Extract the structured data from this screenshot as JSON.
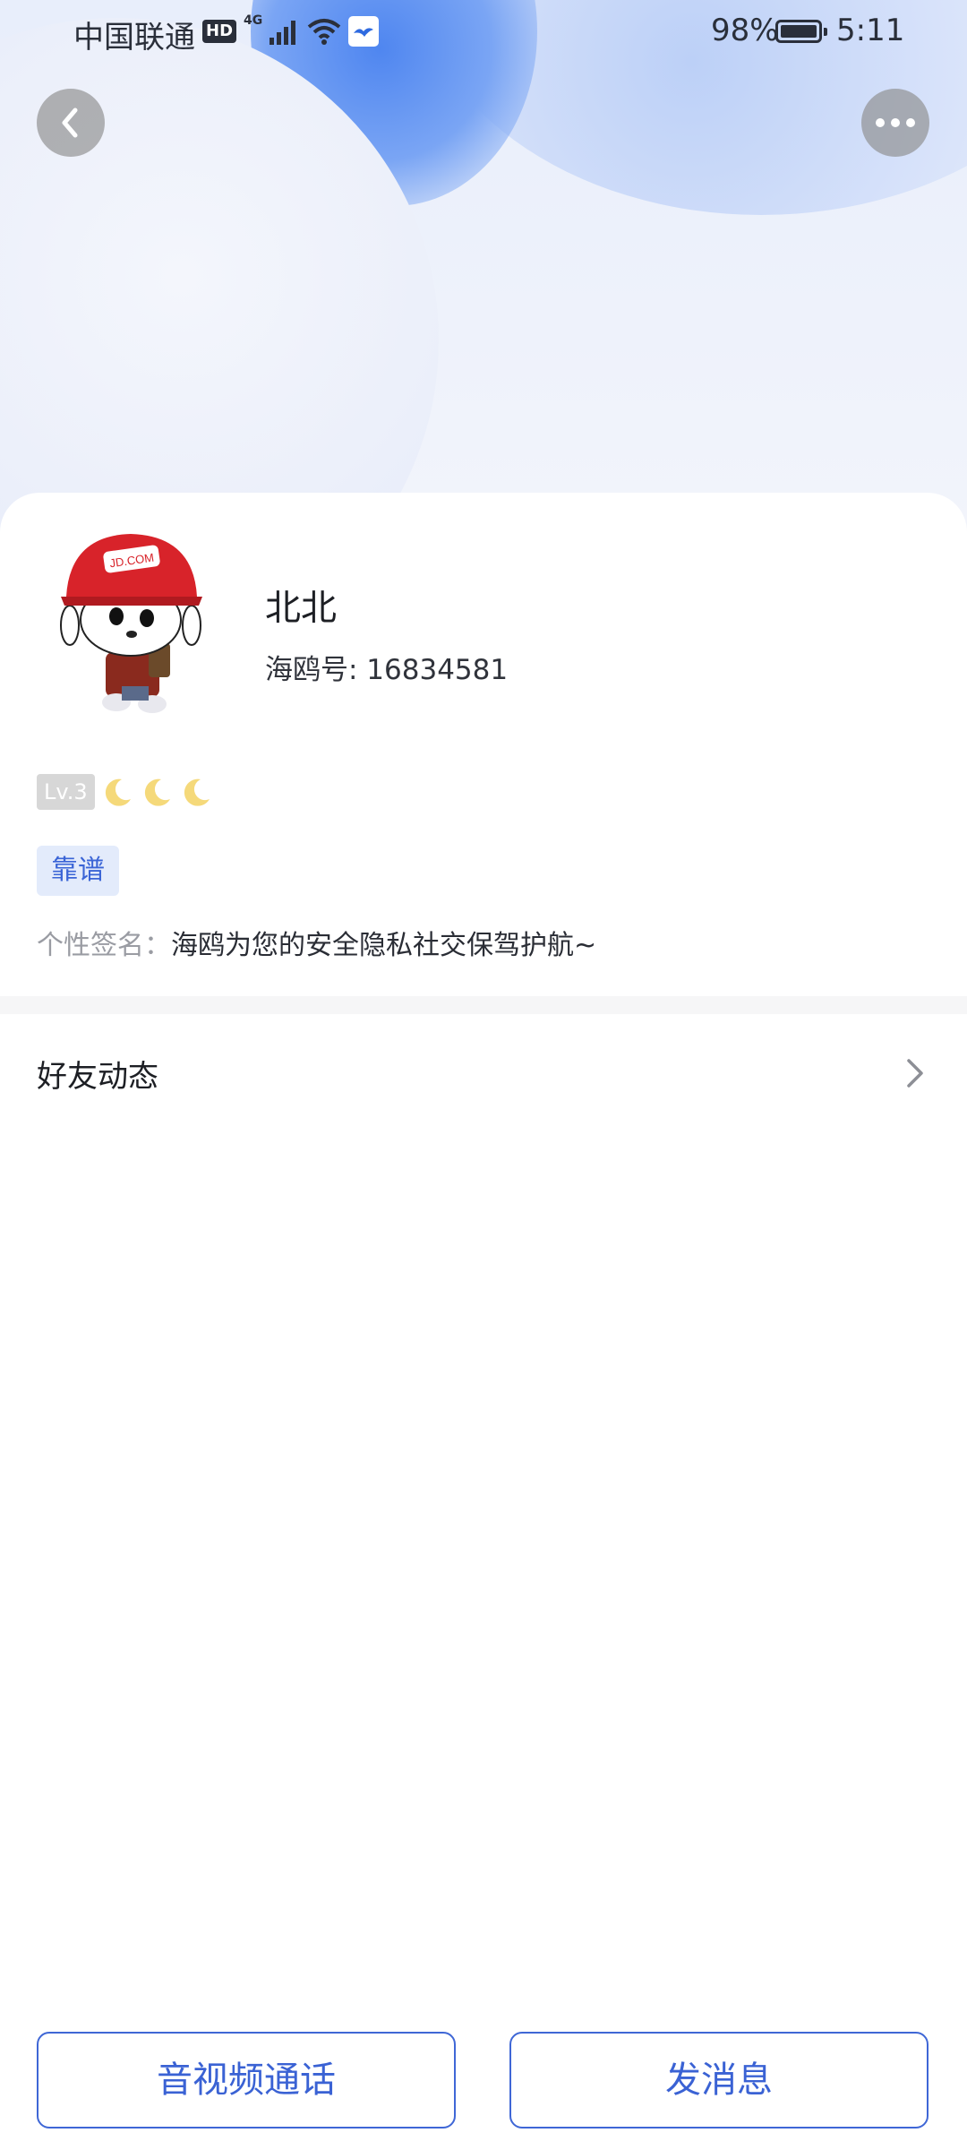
{
  "status_bar": {
    "carrier": "中国联通",
    "hd_badge": "HD",
    "network": "4G",
    "battery_percent": "98%",
    "time": "5:11"
  },
  "nav": {
    "back_icon": "chevron-left-icon",
    "more_icon": "more-dots-icon"
  },
  "profile": {
    "name": "北北",
    "id_text": "海鸥号: 16834581",
    "avatar_text": "JD.COM",
    "level": "Lv.3",
    "level_moons": 3,
    "tag": "靠谱",
    "signature_label": "个性签名：",
    "signature": "海鸥为您的安全隐私社交保驾护航~"
  },
  "feed": {
    "label": "好友动态"
  },
  "actions": {
    "call_label": "音视频通话",
    "message_label": "发消息"
  },
  "colors": {
    "accent": "#3a62d4",
    "tag_bg": "#e3ebfb",
    "level_badge": "#d7d7d7",
    "moon": "#f5d97a"
  }
}
